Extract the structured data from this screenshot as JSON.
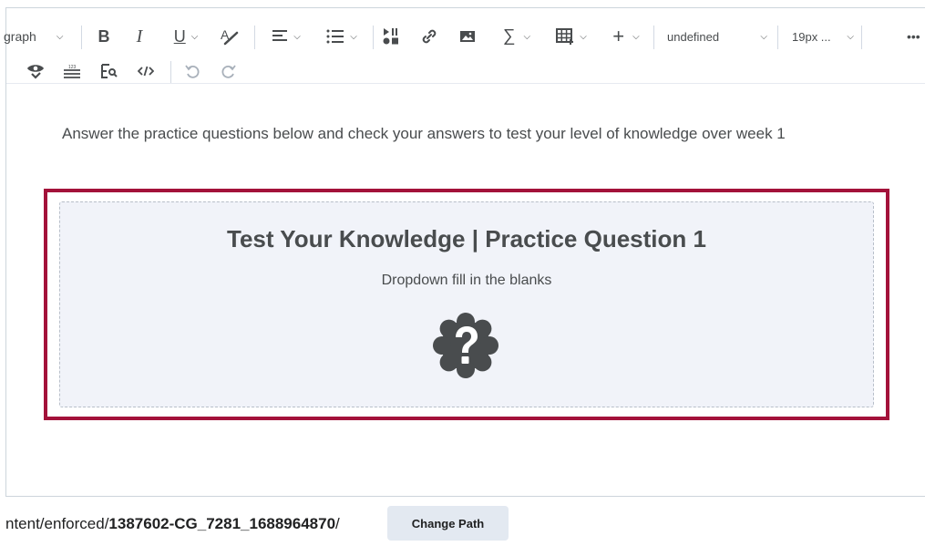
{
  "toolbar": {
    "format_block": "graph",
    "font_family": "undefined",
    "font_size": "19px ...",
    "more": "•••",
    "sum_symbol": "∑",
    "plus_symbol": "+"
  },
  "content": {
    "intro": "Answer the practice questions below and check your answers to test your level of knowledge over week 1",
    "card_title": "Test Your Knowledge | Practice Question 1",
    "card_subtitle": "Dropdown fill in the blanks"
  },
  "path": {
    "prefix": "ntent/enforced/",
    "bold": "1387602-CG_7281_1688964870",
    "suffix": "/",
    "button": "Change Path"
  },
  "colors": {
    "highlight_border": "#a3123a",
    "card_bg": "#f1f3f9",
    "button_bg": "#e3e9f1"
  }
}
